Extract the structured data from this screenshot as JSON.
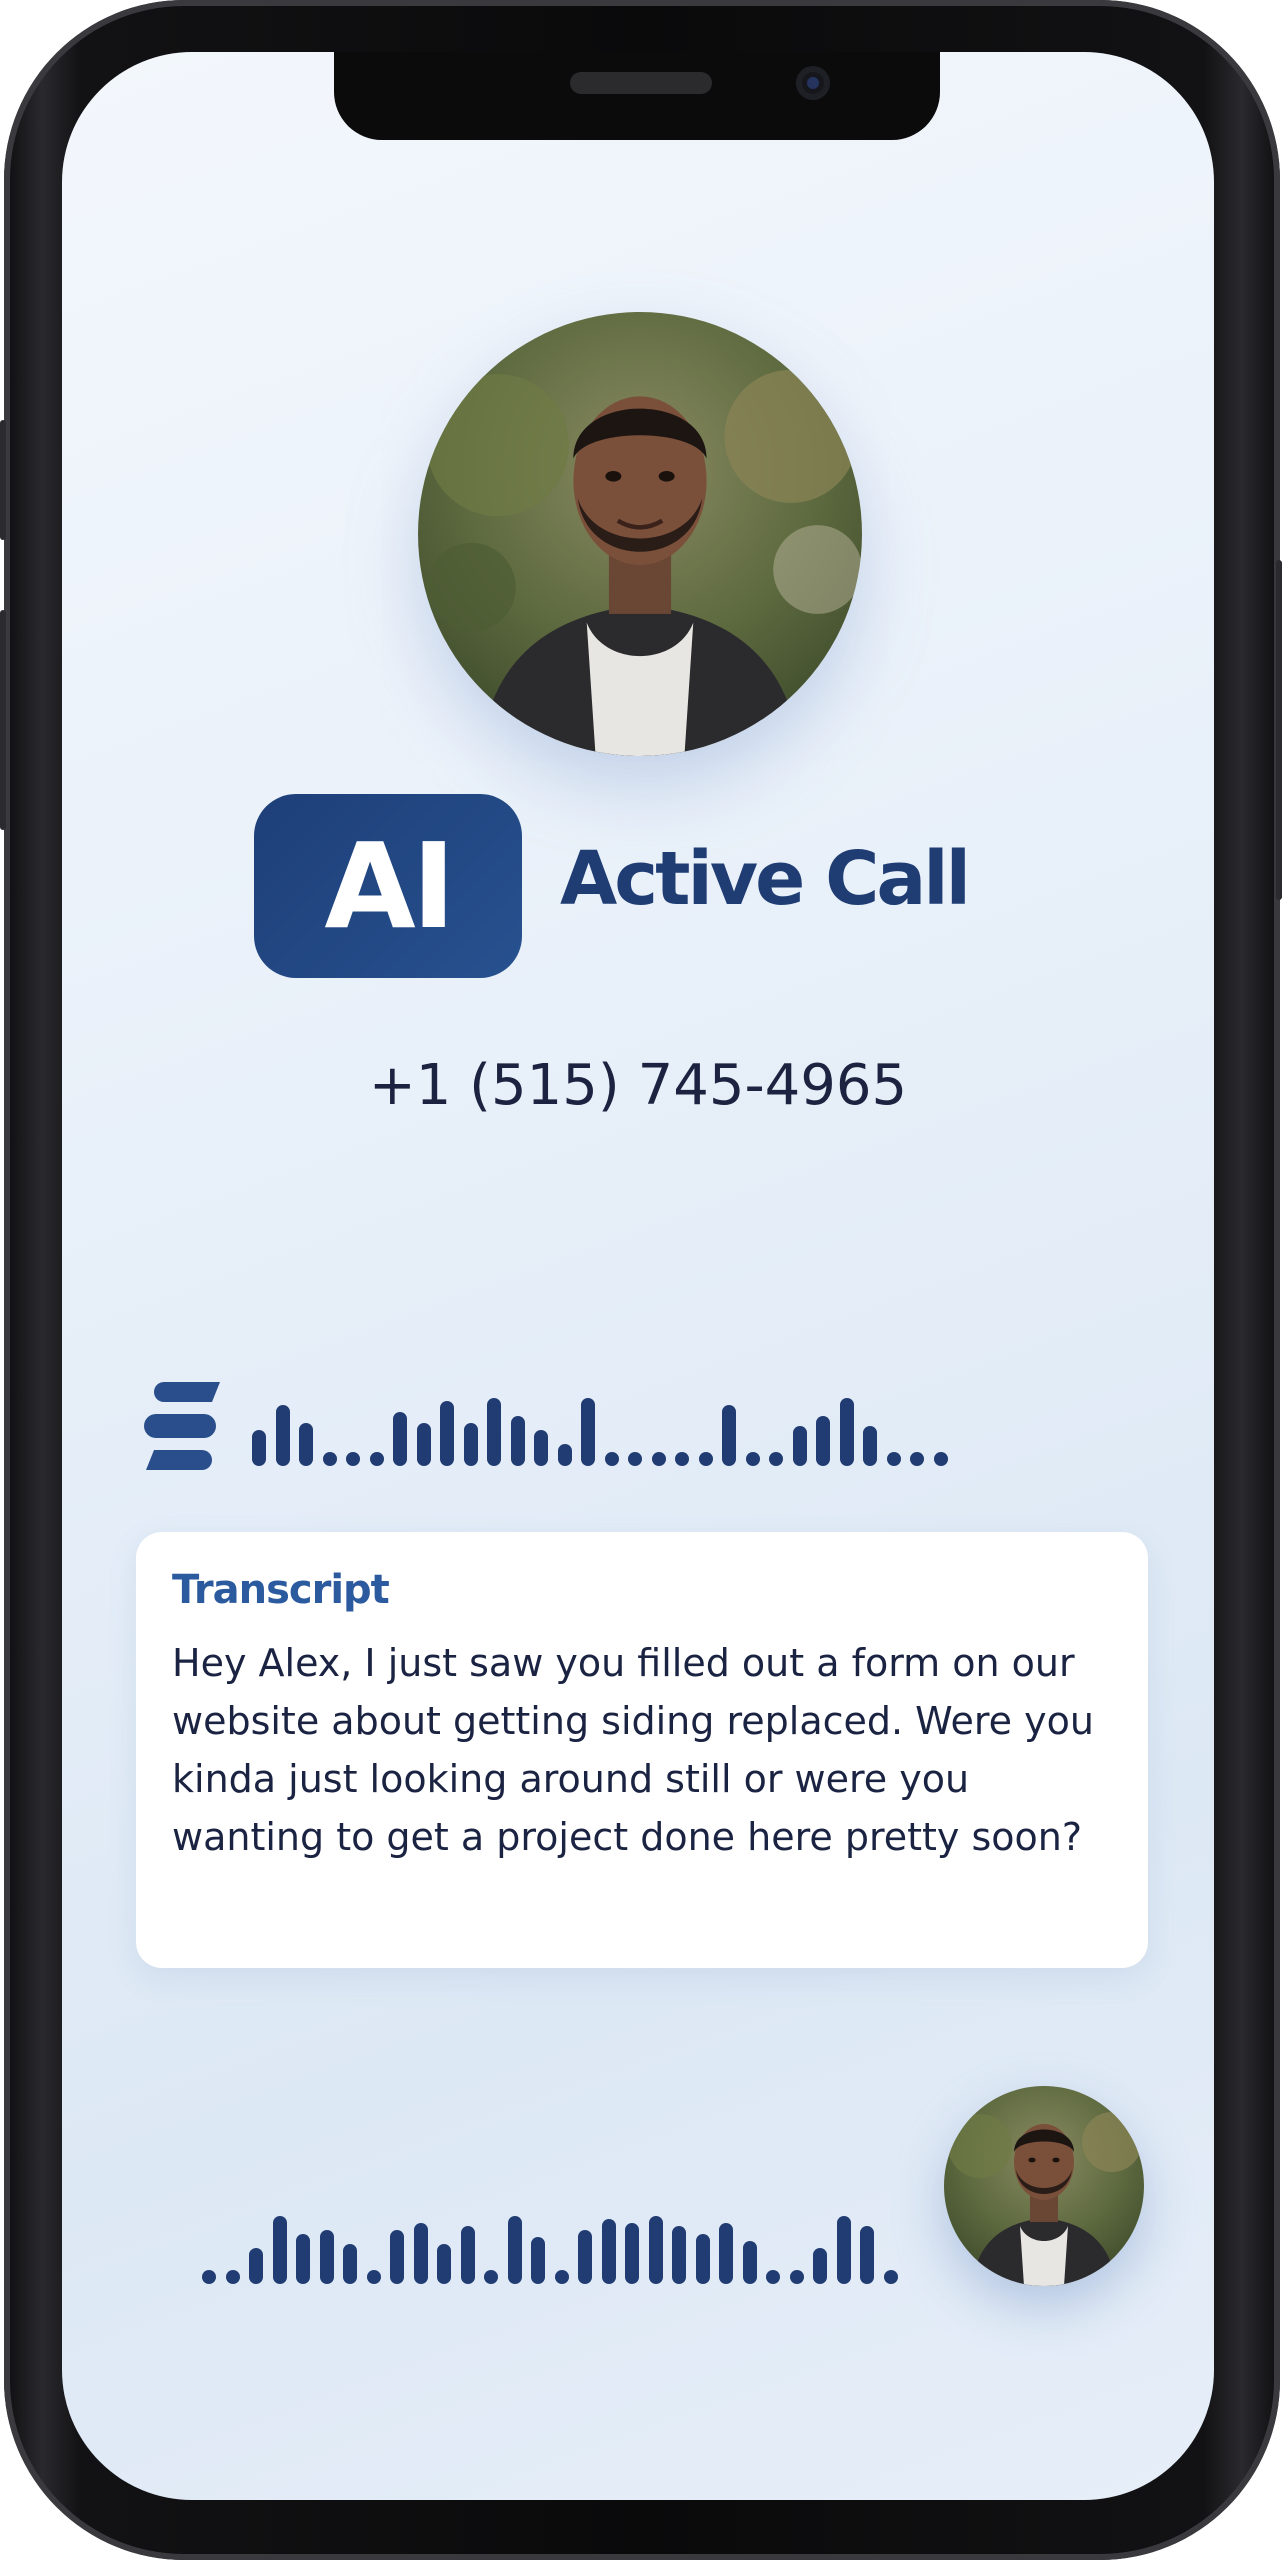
{
  "call": {
    "badge": "AI",
    "status": "Active Call",
    "phone_number": "+1 (515) 745-4965"
  },
  "transcript": {
    "label": "Transcript",
    "text": "Hey Alex, I just saw you filled out a form on our website about getting siding replaced. Were you kinda just looking around still or were you wanting to get a project done here pretty soon?"
  },
  "icons": {
    "brand": "brand-s-logo-icon",
    "ai_waveform": "ai-voice-waveform-icon",
    "caller_waveform": "caller-voice-waveform-icon"
  },
  "colors": {
    "brand_navy": "#1f3c73",
    "brand_blue": "#2c5a9e",
    "waveform": "#203c72",
    "text_dark": "#1b2342"
  },
  "waveforms": {
    "ai_levels": [
      0.5,
      0.85,
      0.6,
      0.2,
      0.2,
      0.2,
      0.75,
      0.6,
      0.9,
      0.6,
      0.95,
      0.7,
      0.5,
      0.3,
      0.95,
      0.2,
      0.2,
      0.2,
      0.2,
      0.2,
      0.85,
      0.2,
      0.2,
      0.55,
      0.7,
      0.95,
      0.55,
      0.2,
      0.2,
      0.2
    ],
    "caller_levels": [
      0.2,
      0.2,
      0.5,
      0.95,
      0.7,
      0.75,
      0.55,
      0.2,
      0.75,
      0.85,
      0.55,
      0.8,
      0.2,
      0.95,
      0.65,
      0.2,
      0.75,
      0.9,
      0.85,
      0.95,
      0.8,
      0.7,
      0.85,
      0.6,
      0.2,
      0.2,
      0.5,
      0.95,
      0.8,
      0.2
    ]
  }
}
